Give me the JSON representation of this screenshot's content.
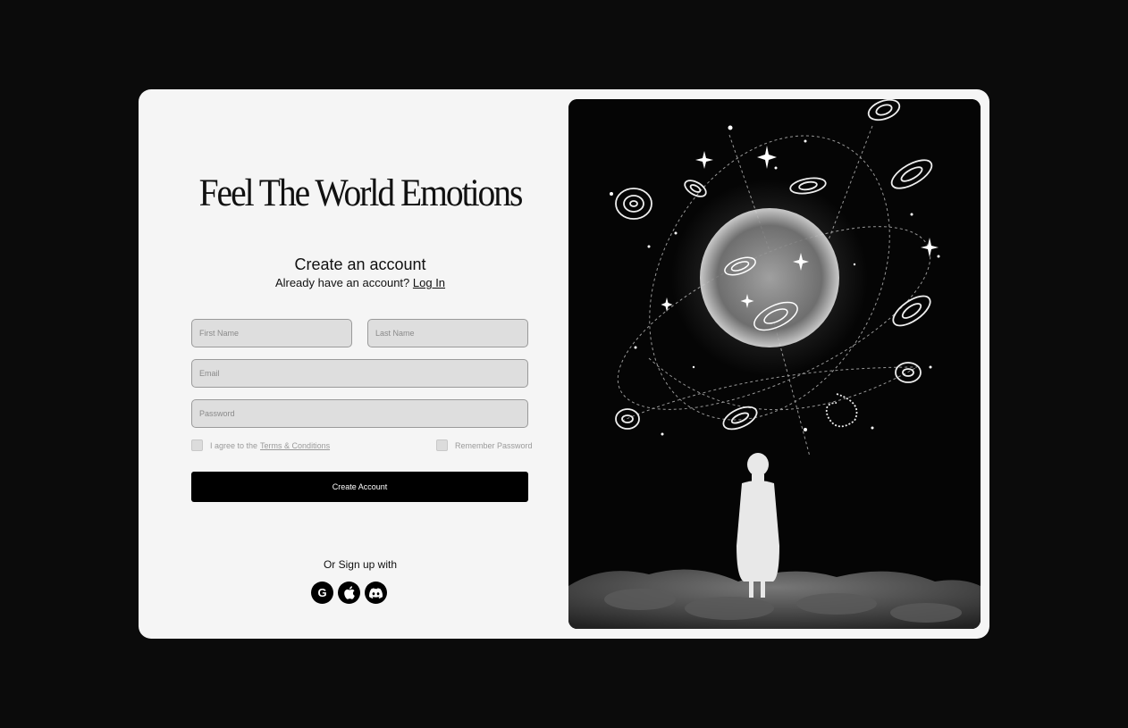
{
  "headline": "Feel The World Emotions",
  "form": {
    "title": "Create an account",
    "have_account_text": "Already have an account?",
    "login_link": "Log In",
    "first_name_placeholder": "First Name",
    "last_name_placeholder": "Last Name",
    "email_placeholder": "Email",
    "password_placeholder": "Password",
    "agree_text": "I agree to the",
    "terms_link": "Terms & Conditions",
    "remember_text": "Remember Password",
    "submit_label": "Create Account",
    "or_signup_text": "Or Sign up with"
  },
  "socials": [
    {
      "icon": "google-icon",
      "glyph": "G"
    },
    {
      "icon": "apple-icon",
      "glyph": ""
    },
    {
      "icon": "discord-icon",
      "glyph": ""
    }
  ],
  "colors": {
    "page_bg": "#0b0b0b",
    "card_bg": "#f5f5f5",
    "input_bg": "#dedede",
    "button_bg": "#000000"
  }
}
